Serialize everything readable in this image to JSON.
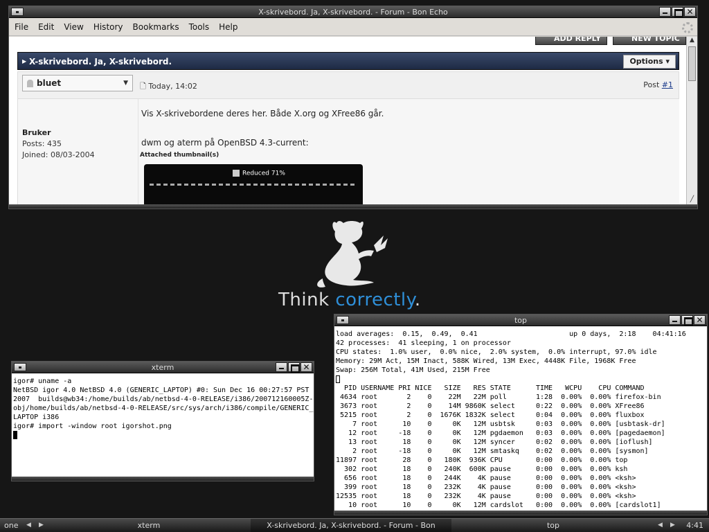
{
  "firefox": {
    "title": "X-skrivebord. Ja, X-skrivebord. - Forum - Bon Echo",
    "menu": [
      "File",
      "Edit",
      "View",
      "History",
      "Bookmarks",
      "Tools",
      "Help"
    ],
    "add_reply": "ADD REPLY",
    "new_topic": "NEW TOPIC",
    "thread_title": "X-skrivebord. Ja, X-skrivebord.",
    "options": "Options",
    "username": "bluet",
    "post_date": "Today, 14:02",
    "post_label": "Post",
    "post_number": "#1",
    "rank": "Bruker",
    "posts": "Posts: 435",
    "joined": "Joined: 08/03-2004",
    "message_line1": "Vis X-skrivebordene deres her. Både X.org og XFree86 går.",
    "message_line2": "dwm og aterm på OpenBSD 4.3-current:",
    "attached": "Attached thumbnail(s)",
    "thumb_label": "Reduced 71%"
  },
  "desktop": {
    "tagline_a": "Think ",
    "tagline_b": "correctly",
    "tagline_c": "."
  },
  "xterm": {
    "title": "xterm",
    "lines": [
      "igor# uname -a",
      "NetBSD igor 4.0 NetBSD 4.0 (GENERIC_LAPTOP) #0: Sun Dec 16 00:27:57 PST",
      "2007  builds@wb34:/home/builds/ab/netbsd-4-0-RELEASE/i386/200712160005Z-",
      "obj/home/builds/ab/netbsd-4-0-RELEASE/src/sys/arch/i386/compile/GENERIC_",
      "LAPTOP i386",
      "igor# import -window root igorshot.png"
    ]
  },
  "top": {
    "title": "top",
    "header": [
      "load averages:  0.15,  0.49,  0.41                      up 0 days,  2:18    04:41:16",
      "42 processes:  41 sleeping, 1 on processor",
      "CPU states:  1.0% user,  0.0% nice,  2.0% system,  0.0% interrupt, 97.0% idle",
      "Memory: 29M Act, 15M Inact, 588K Wired, 13M Exec, 4448K File, 1968K Free",
      "Swap: 256M Total, 41M Used, 215M Free"
    ],
    "columns": "  PID USERNAME PRI NICE   SIZE   RES STATE      TIME   WCPU    CPU COMMAND",
    "rows": [
      " 4634 root       2    0    22M   22M poll       1:28  0.00%  0.00% firefox-bin",
      " 3673 root       2    0    14M 9860K select     0:22  0.00%  0.00% XFree86",
      " 5215 root       2    0  1676K 1832K select     0:04  0.00%  0.00% fluxbox",
      "    7 root      10    0     0K   12M usbtsk     0:03  0.00%  0.00% [usbtask-dr]",
      "   12 root     -18    0     0K   12M pgdaemon   0:03  0.00%  0.00% [pagedaemon]",
      "   13 root      18    0     0K   12M syncer     0:02  0.00%  0.00% [ioflush]",
      "    2 root     -18    0     0K   12M smtaskq    0:02  0.00%  0.00% [sysmon]",
      "11897 root      28    0   180K  936K CPU        0:00  0.00%  0.00% top",
      "  302 root      18    0   240K  600K pause      0:00  0.00%  0.00% ksh",
      "  656 root      18    0   244K    4K pause      0:00  0.00%  0.00% <ksh>",
      "  399 root      18    0   232K    4K pause      0:00  0.00%  0.00% <ksh>",
      "12535 root      18    0   232K    4K pause      0:00  0.00%  0.00% <ksh>",
      "   10 root      10    0     0K   12M cardslot   0:00  0.00%  0.00% [cardslot1]"
    ]
  },
  "taskbar": {
    "workspace": "one",
    "items": [
      "xterm",
      "X-skrivebord. Ja, X-skrivebord. - Forum - Bon",
      "top"
    ],
    "clock": "4:41"
  }
}
